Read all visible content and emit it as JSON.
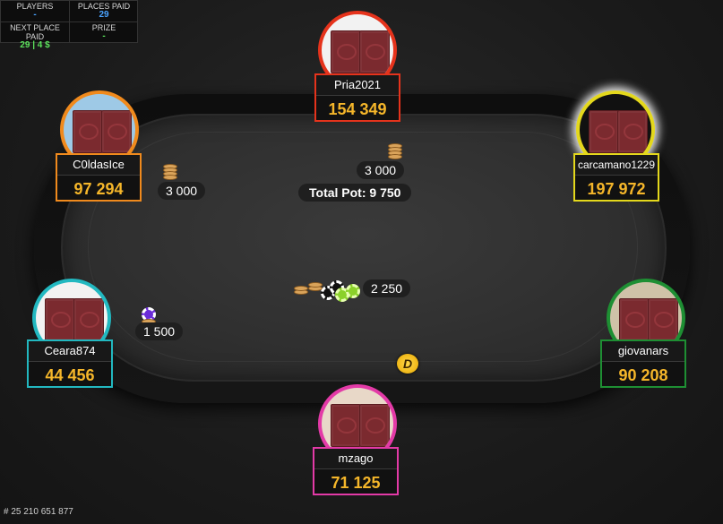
{
  "info": {
    "players_label": "PLAYERS",
    "players_value": "-",
    "places_paid_label": "PLACES PAID",
    "places_paid_value": "29",
    "next_place_label": "NEXT PLACE PAID",
    "next_place_value": "29 | 4 $",
    "prize_label": "PRIZE",
    "prize_value": "-"
  },
  "seats": {
    "top": {
      "name": "Pria2021",
      "stack": "154 349",
      "color": "#e5331c"
    },
    "top_left": {
      "name": "C0ldasIce",
      "stack": "97 294",
      "color": "#f08a1d"
    },
    "top_right": {
      "name": "carcamano1229",
      "stack": "197 972",
      "color": "#e4d81c"
    },
    "left": {
      "name": "Ceara874",
      "stack": "44 456",
      "color": "#22b8c0"
    },
    "right": {
      "name": "giovanars",
      "stack": "90 208",
      "color": "#1e8f33"
    },
    "bottom": {
      "name": "mzago",
      "stack": "71 125",
      "color": "#e33aa7"
    }
  },
  "bets": {
    "top_left": "3 000",
    "top": "3 000",
    "left": "1 500",
    "center": "2 250"
  },
  "pot": "Total Pot: 9 750",
  "dealer_label": "D",
  "hand_id": "# 25 210 651 877"
}
